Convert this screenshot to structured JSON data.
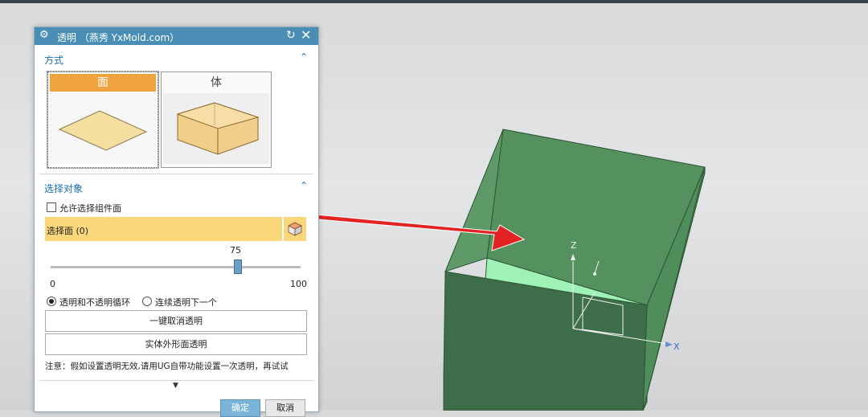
{
  "dialog": {
    "title": "透明 （燕秀 YxMold.com）",
    "section_method": "方式",
    "mode_face": "面",
    "mode_body": "体",
    "section_select": "选择对象",
    "allow_component_faces": "允许选择组件面",
    "select_faces": "选择面 (0)",
    "slider": {
      "value": "75",
      "min": "0",
      "max": "100",
      "level": 0.75
    },
    "radio_cycle": "透明和不透明循环",
    "radio_next": "连续透明下一个",
    "btn_cancel_all": "一键取消透明",
    "btn_outer_faces": "实体外形面透明",
    "note": "注意：假如设置透明无效,请用UG自带功能设置一次透明，再试试",
    "ok": "确定",
    "cancel": "取消"
  },
  "viewport": {
    "axis_z": "Z",
    "axis_x": "X",
    "solid_color": "#4f8d5f",
    "selected_face_color": "#9ff2b6",
    "arrow_color": "#e32323"
  },
  "icons": [
    "gear-icon",
    "reset-icon",
    "close-icon",
    "chevron-up-icon",
    "cube-select-icon",
    "expand-arrow-icon"
  ]
}
